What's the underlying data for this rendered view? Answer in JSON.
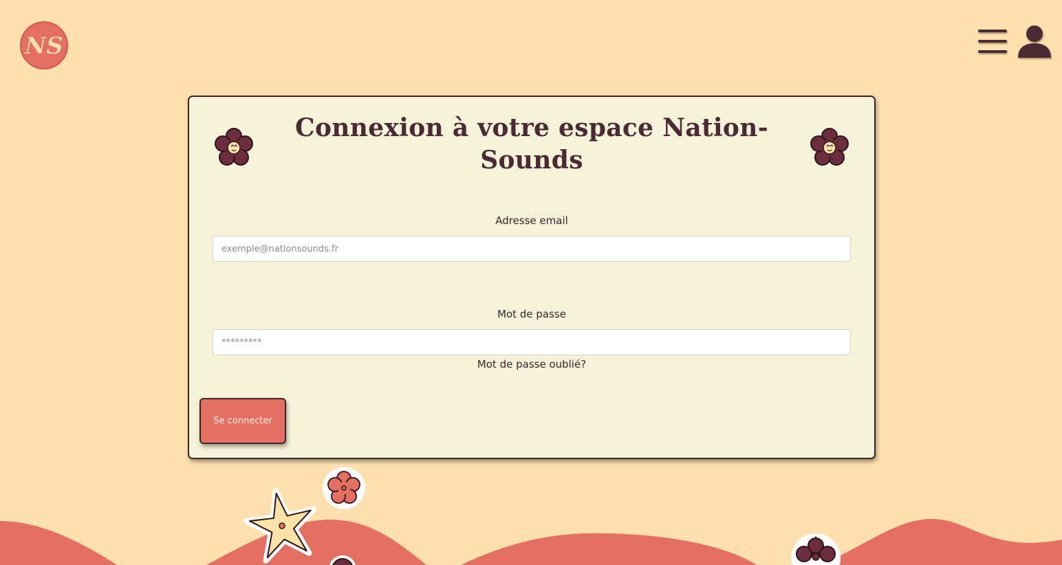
{
  "header": {
    "logo_text": "NS",
    "menu_icon": "hamburger-menu-icon",
    "user_icon": "user-account-icon"
  },
  "login": {
    "title": "Connexion à votre espace Nation-Sounds",
    "email_label": "Adresse email",
    "email_placeholder": "exemple@nationsounds.fr",
    "email_value": "",
    "password_label": "Mot de passe",
    "password_placeholder": "*********",
    "password_value": "",
    "forgot_link": "Mot de passe oublié?",
    "submit_label": "Se connecter"
  },
  "colors": {
    "background": "#fee0ae",
    "card": "#f5f2da",
    "accent": "#e37063",
    "dark": "#4a2a33",
    "flower_dark": "#6b2d3f",
    "flower_yellow": "#fbe2a6"
  }
}
